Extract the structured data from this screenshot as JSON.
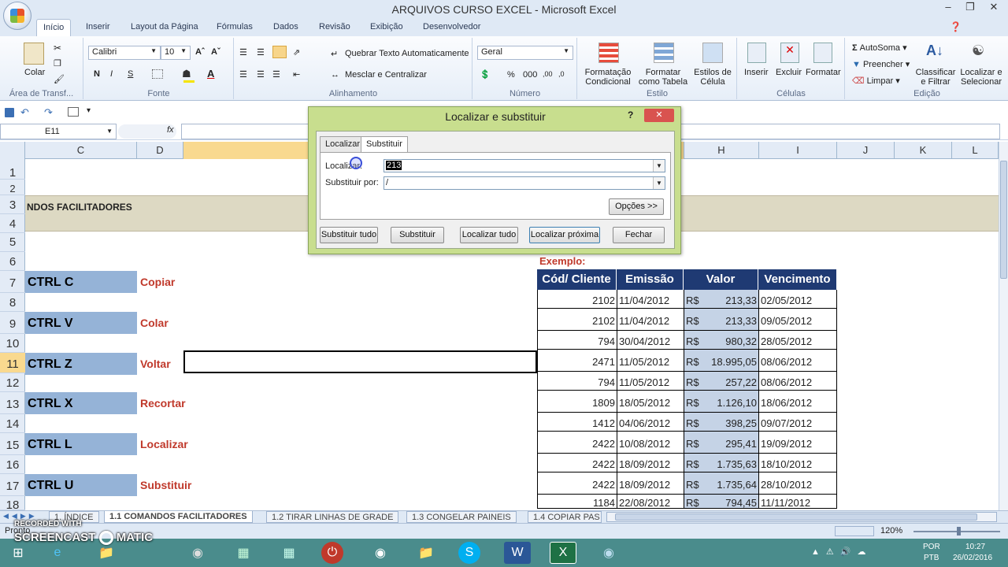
{
  "window": {
    "title": "ARQUIVOS CURSO EXCEL - Microsoft Excel"
  },
  "ribbon_tabs": [
    "Início",
    "Inserir",
    "Layout da Página",
    "Fórmulas",
    "Dados",
    "Revisão",
    "Exibição",
    "Desenvolvedor"
  ],
  "ribbon": {
    "clipboard": {
      "paste": "Colar",
      "group": "Área de Transf..."
    },
    "font": {
      "name": "Calibri",
      "size": "10",
      "bold": "N",
      "italic": "I",
      "underline": "S",
      "group": "Fonte"
    },
    "alignment": {
      "wrap": "Quebrar Texto Automaticamente",
      "merge": "Mesclar e Centralizar",
      "group": "Alinhamento"
    },
    "number": {
      "format": "Geral",
      "percent": "%",
      "thousands": "000",
      "group": "Número"
    },
    "styles": {
      "cond": "Formatação Condicional",
      "table": "Formatar como Tabela",
      "cell": "Estilos de Célula",
      "group": "Estilo"
    },
    "cells": {
      "insert": "Inserir",
      "delete": "Excluir",
      "format": "Formatar",
      "group": "Células"
    },
    "editing": {
      "autosum": "AutoSoma",
      "fill": "Preencher",
      "clear": "Limpar",
      "sort": "Classificar e Filtrar",
      "find": "Localizar e Selecionar",
      "group": "Edição"
    }
  },
  "namebox": "E11",
  "fx": "fx",
  "columns": [
    "C",
    "D",
    "H",
    "I",
    "J",
    "K",
    "L"
  ],
  "rows": [
    "1",
    "2",
    "3",
    "4",
    "5",
    "6",
    "7",
    "8",
    "9",
    "10",
    "11",
    "12",
    "13",
    "14",
    "15",
    "16",
    "17",
    "18"
  ],
  "sheet": {
    "banner": "NDOS FACILITADORES",
    "shortcuts": [
      {
        "key": "CTRL C",
        "action": "Copiar"
      },
      {
        "key": "CTRL V",
        "action": "Colar"
      },
      {
        "key": "CTRL Z",
        "action": "Voltar"
      },
      {
        "key": "CTRL X",
        "action": "Recortar"
      },
      {
        "key": "CTRL L",
        "action": "Localizar"
      },
      {
        "key": "CTRL U",
        "action": "Substituir"
      }
    ],
    "example_label": "Exemplo:",
    "table_headers": [
      "Cód/ Cliente",
      "Emissão",
      "Valor",
      "Vencimento"
    ],
    "currency": "R$",
    "table_rows": [
      [
        "2102",
        "11/04/2012",
        "213,33",
        "02/05/2012"
      ],
      [
        "2102",
        "11/04/2012",
        "213,33",
        "09/05/2012"
      ],
      [
        "794",
        "30/04/2012",
        "980,32",
        "28/05/2012"
      ],
      [
        "2471",
        "11/05/2012",
        "18.995,05",
        "08/06/2012"
      ],
      [
        "794",
        "11/05/2012",
        "257,22",
        "08/06/2012"
      ],
      [
        "1809",
        "18/05/2012",
        "1.126,10",
        "18/06/2012"
      ],
      [
        "1412",
        "04/06/2012",
        "398,25",
        "09/07/2012"
      ],
      [
        "2422",
        "10/08/2012",
        "295,41",
        "19/09/2012"
      ],
      [
        "2422",
        "18/09/2012",
        "1.735,63",
        "18/10/2012"
      ],
      [
        "2422",
        "18/09/2012",
        "1.735,64",
        "28/10/2012"
      ],
      [
        "1184",
        "22/08/2012",
        "794,45",
        "11/11/2012"
      ]
    ]
  },
  "dialog": {
    "title": "Localizar e substituir",
    "help": "?",
    "tabs": [
      "Localizar",
      "Substituir"
    ],
    "find_label": "Localizar:",
    "find_value": "213",
    "replace_label": "Substituir por:",
    "replace_value": "/",
    "options": "Opções >>",
    "buttons": [
      "Substituir tudo",
      "Substituir",
      "Localizar tudo",
      "Localizar próxima",
      "Fechar"
    ]
  },
  "sheet_tabs": [
    "1. ÍNDICE",
    "1.1 COMANDOS FACILITADORES",
    "1.2 TIRAR LINHAS DE GRADE",
    "1.3 CONGELAR PAINEIS",
    "1.4 COPIAR PAS"
  ],
  "status": {
    "mode": "Pronto",
    "zoom": "120%"
  },
  "watermark": {
    "line1": "RECORDED WITH",
    "line2": "SCREENCAST",
    "line3": "MATIC"
  },
  "taskbar": {
    "lang1": "POR",
    "lang2": "PTB",
    "time": "10:27",
    "date": "26/02/2016"
  }
}
